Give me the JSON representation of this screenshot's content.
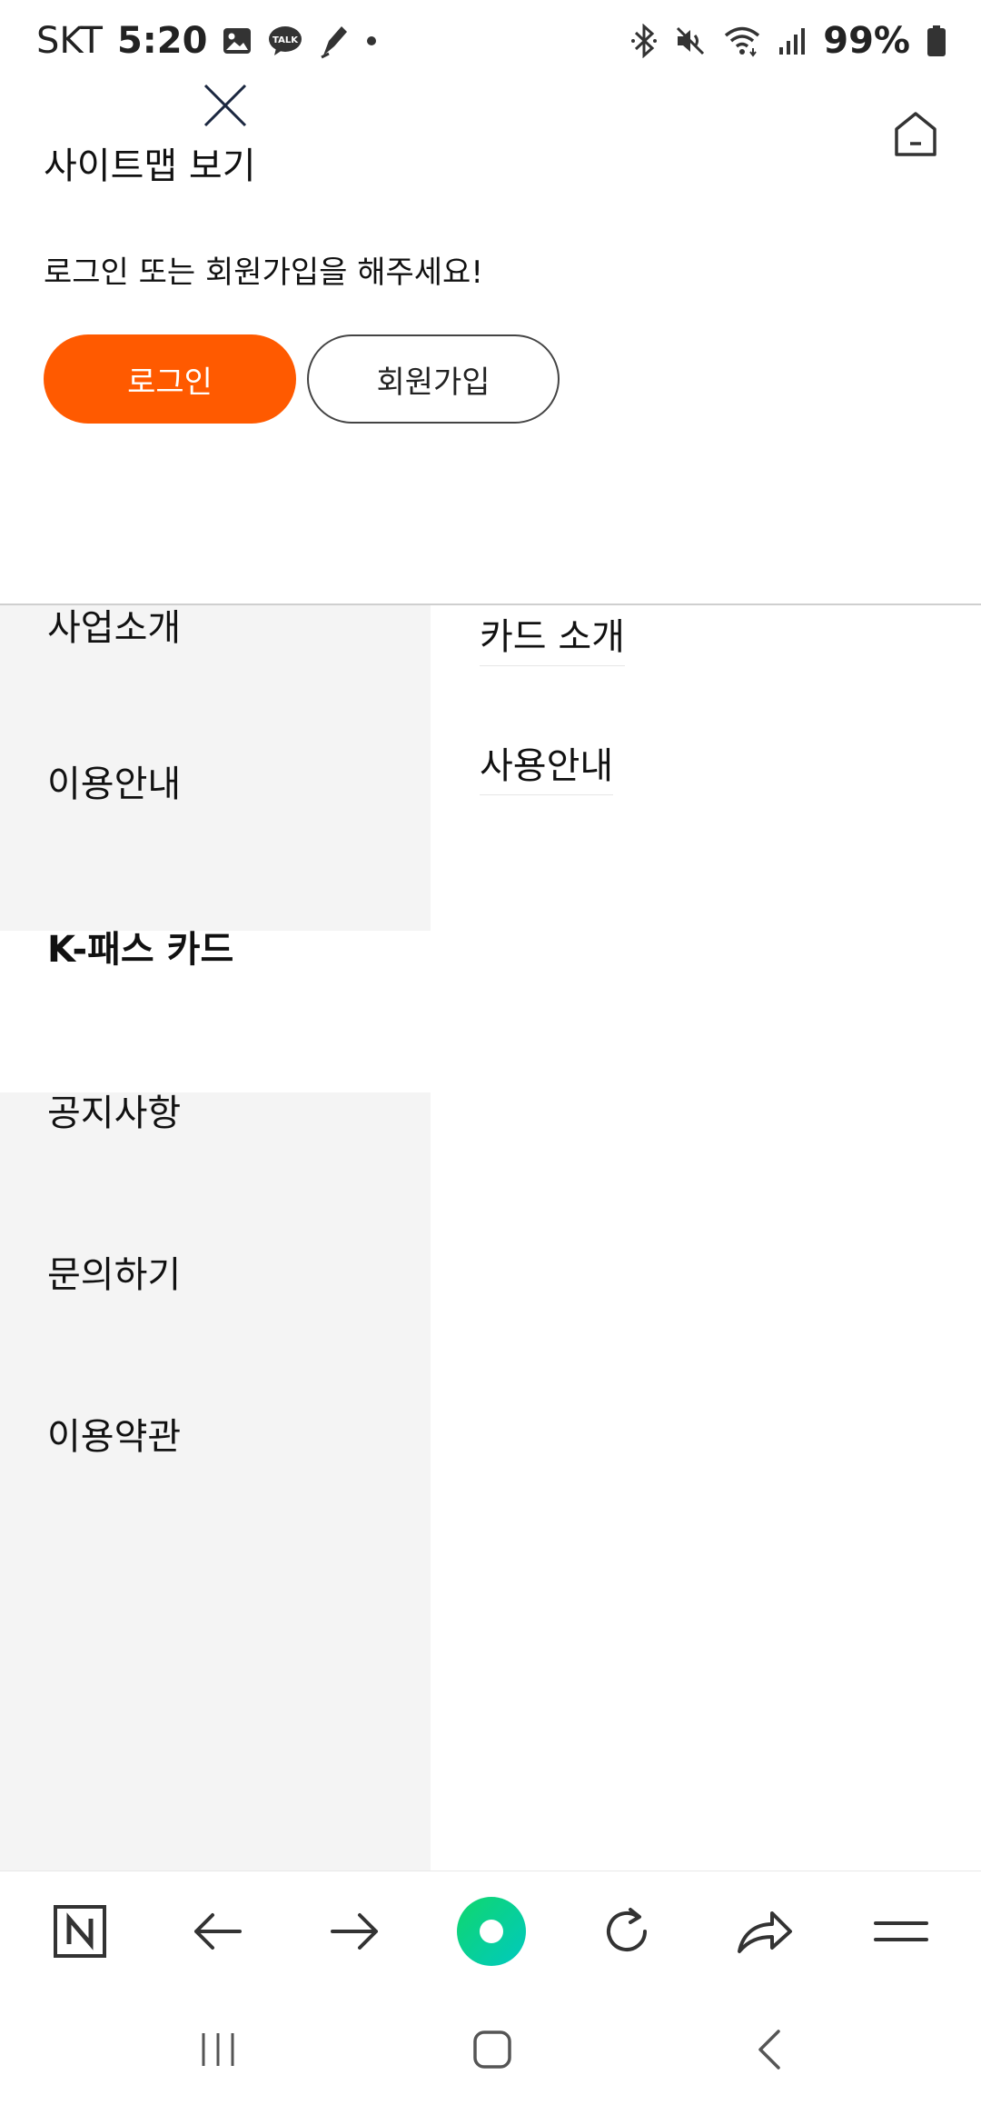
{
  "status_bar": {
    "carrier": "SKT",
    "time": "5:20",
    "battery": "99%",
    "left_icons": [
      "image-notification-icon",
      "kakaotalk-icon",
      "pen-app-icon",
      "notification-dot-icon"
    ],
    "right_icons": [
      "bluetooth-icon",
      "mute-icon",
      "wifi-icon",
      "signal-icon",
      "battery-icon"
    ]
  },
  "header": {
    "title": "사이트맵 보기",
    "close_icon": "close-icon",
    "home_icon": "home-icon"
  },
  "auth": {
    "prompt": "로그인 또는 회원가입을 해주세요!",
    "login_label": "로그인",
    "signup_label": "회원가입",
    "login_color": "#ff5a00"
  },
  "sitemap": {
    "left_menu": [
      {
        "label": "사업소개"
      },
      {
        "label": "이용안내"
      },
      {
        "label": "K-패스 카드"
      },
      {
        "label": "공지사항"
      },
      {
        "label": "문의하기"
      },
      {
        "label": "이용약관"
      }
    ],
    "active_index": 2,
    "sub_menu": [
      {
        "label": "카드 소개"
      },
      {
        "label": "사용안내"
      }
    ]
  },
  "browser_toolbar": {
    "items": [
      "naver-n-icon",
      "back-arrow-icon",
      "forward-arrow-icon",
      "green-circle-icon",
      "refresh-icon",
      "share-icon",
      "menu-icon"
    ],
    "accent_color": "#03c75a"
  },
  "android_nav": {
    "items": [
      "recent-apps-icon",
      "home-icon",
      "back-icon"
    ]
  }
}
